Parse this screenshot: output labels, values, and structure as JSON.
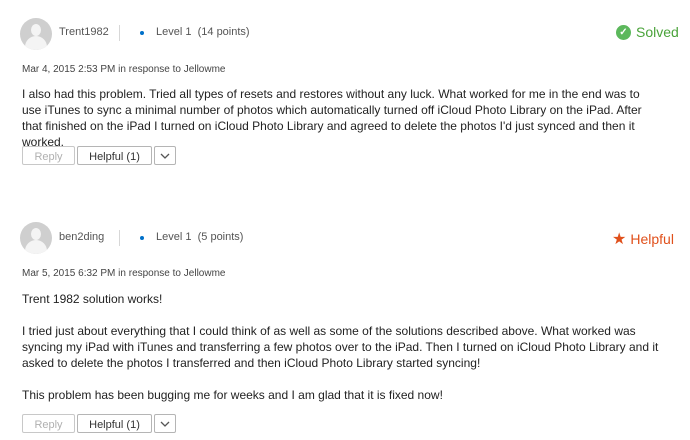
{
  "posts": [
    {
      "username": "Trent1982",
      "level": "Level 1",
      "points": "(14 points)",
      "status": "Solved",
      "status_icon": "check-circle-icon",
      "date": "Mar 4, 2015 2:53 PM",
      "response_prefix": "in response to",
      "response_to": "Jellowme",
      "paragraphs": [
        "I also had this problem.  Tried all types of resets and restores without any luck.  What worked for me in the end was to use iTunes to sync a minimal number of photos which automatically turned off iCloud Photo Library on the iPad.  After that finished on the iPad I turned on iCloud Photo Library and agreed to delete the photos I'd just synced and then it worked."
      ],
      "reply_label": "Reply",
      "helpful_label": "Helpful (1)"
    },
    {
      "username": "ben2ding",
      "level": "Level 1",
      "points": "(5 points)",
      "status": "Helpful",
      "status_icon": "star-icon",
      "date": "Mar 5, 2015 6:32 PM",
      "response_prefix": "in response to",
      "response_to": "Jellowme",
      "paragraphs": [
        "Trent 1982 solution works!",
        "I tried just about everything that I could think of as well as some of the solutions described above.  What worked was syncing my iPad with iTunes and transferring a few photos over to the iPad.  Then I turned on iCloud Photo Library and it asked to delete the photos I transferred and then iCloud Photo Library started syncing!",
        "This problem has been bugging me for weeks and I am glad that it is fixed now!"
      ],
      "reply_label": "Reply",
      "helpful_label": "Helpful (1)"
    }
  ],
  "colors": {
    "solved": "#4aa33a",
    "helpful": "#e0501b",
    "level_dot": "#0070c9"
  }
}
